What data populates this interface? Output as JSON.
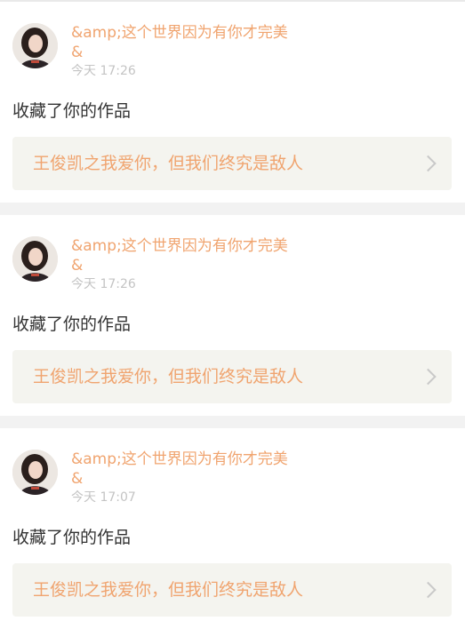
{
  "feed": [
    {
      "nickname": "&amp;这个世界因为有你才完美\n&",
      "time": "今天 17:26",
      "action": "收藏了你的作品",
      "work_title": "王俊凯之我爱你，但我们终究是敌人"
    },
    {
      "nickname": "&amp;这个世界因为有你才完美\n&",
      "time": "今天 17:26",
      "action": "收藏了你的作品",
      "work_title": "王俊凯之我爱你，但我们终究是敌人"
    },
    {
      "nickname": "&amp;这个世界因为有你才完美\n&",
      "time": "今天 17:07",
      "action": "收藏了你的作品",
      "work_title": "王俊凯之我爱你，但我们终究是敌人"
    }
  ],
  "icons": {
    "chevron": "chevron-right-icon",
    "avatar": "user-avatar"
  },
  "colors": {
    "accent": "#f0a46f",
    "time": "#c4c4c4",
    "text": "#333333",
    "link_bg": "#f4f4ef",
    "page_bg": "#f2f2f2"
  }
}
